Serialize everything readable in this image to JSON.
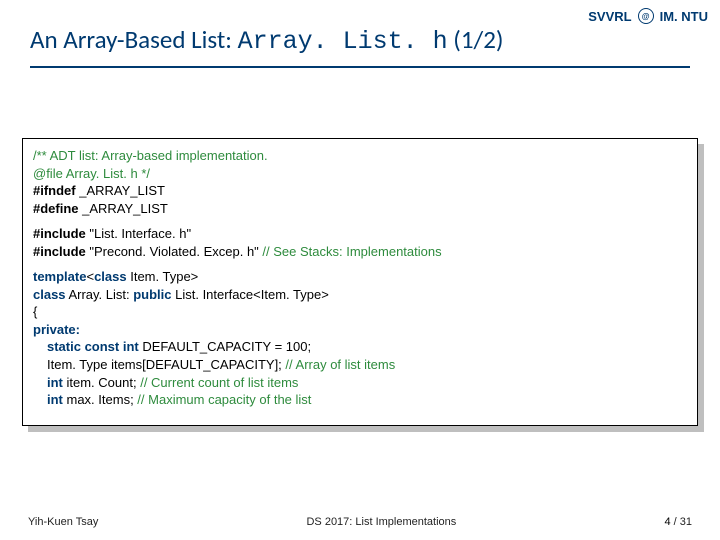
{
  "header": {
    "left_label": "SVVRL",
    "right_label": "IM. NTU"
  },
  "title": {
    "plain_pre": "An Array-Based List: ",
    "code": "Array. List. h",
    "plain_post": " (1/2)"
  },
  "code": {
    "block1": {
      "l1": "/** ADT list: Array-based implementation.",
      "l2": "  @file Array. List. h */",
      "l3_kw": "#ifndef",
      "l3_rest": " _ARRAY_LIST",
      "l4_kw": "#define",
      "l4_rest": " _ARRAY_LIST"
    },
    "block2": {
      "l1_kw": "#include",
      "l1_rest": " \"List. Interface. h\"",
      "l2_kw": "#include",
      "l2_rest": " \"Precond. Violated. Excep. h\"  ",
      "l2_comment": "// See Stacks: Implementations"
    },
    "block3": {
      "l1_kw1": "template",
      "l1_mid": "<",
      "l1_kw2": "class",
      "l1_rest": " Item. Type>",
      "l2_kw1": "class",
      "l2_mid": " Array. List: ",
      "l2_kw2": "public",
      "l2_rest": " List. Interface<Item. Type>",
      "l3": "{",
      "l4_kw": "private:",
      "l5_kw": "static const int",
      "l5_rest": " DEFAULT_CAPACITY = 100;",
      "l6": "Item. Type items[DEFAULT_CAPACITY]; ",
      "l6_comment": "// Array of list items",
      "l7_kw": "int",
      "l7_rest": " item. Count;                             ",
      "l7_comment": "// Current count of list items",
      "l8_kw": "int",
      "l8_rest": " max. Items;                              ",
      "l8_comment": "// Maximum capacity of the list"
    }
  },
  "footer": {
    "author": "Yih-Kuen Tsay",
    "course": "DS 2017: List Implementations",
    "page_current": "4",
    "page_sep": " / ",
    "page_total": "31"
  }
}
